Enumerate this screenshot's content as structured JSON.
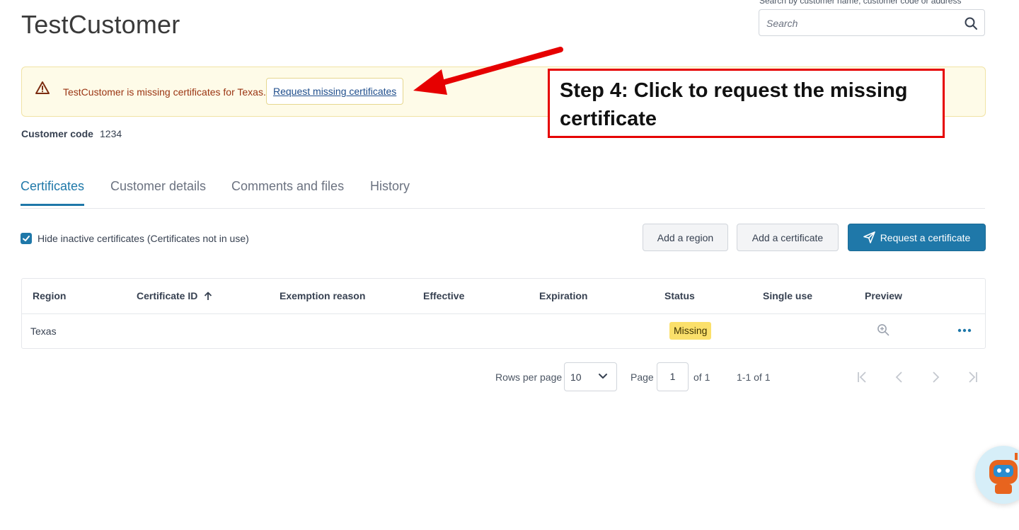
{
  "header": {
    "title": "TestCustomer",
    "search_label": "Search by customer name, customer code or address",
    "search_placeholder": "Search"
  },
  "alert": {
    "message": "TestCustomer is missing certificates for Texas.",
    "action_label": "Request missing certificates"
  },
  "annotation": {
    "text": "Step 4: Click to request the missing certificate"
  },
  "customer": {
    "code_label": "Customer code",
    "code_value": "1234"
  },
  "tabs": [
    {
      "label": "Certificates",
      "active": true
    },
    {
      "label": "Customer details",
      "active": false
    },
    {
      "label": "Comments and files",
      "active": false
    },
    {
      "label": "History",
      "active": false
    }
  ],
  "toolbar": {
    "hide_inactive_label": "Hide inactive certificates (Certificates not in use)",
    "hide_inactive_checked": true,
    "add_region_label": "Add a region",
    "add_certificate_label": "Add a certificate",
    "request_certificate_label": "Request a certificate"
  },
  "table": {
    "columns": [
      "Region",
      "Certificate ID",
      "Exemption reason",
      "Effective",
      "Expiration",
      "Status",
      "Single use",
      "Preview"
    ],
    "rows": [
      {
        "region": "Texas",
        "certificate_id": "",
        "exemption_reason": "",
        "effective": "",
        "expiration": "",
        "status": "Missing",
        "single_use": ""
      }
    ]
  },
  "pagination": {
    "rows_per_page_label": "Rows per page",
    "rows_per_page_value": "10",
    "page_label": "Page",
    "page_value": "1",
    "of_pages": "of 1",
    "range": "1-1 of 1"
  },
  "colors": {
    "accent": "#1f78a9",
    "alert_bg": "#fefbe8",
    "badge_missing": "#fbe06b",
    "annotation_red": "#e60000"
  }
}
